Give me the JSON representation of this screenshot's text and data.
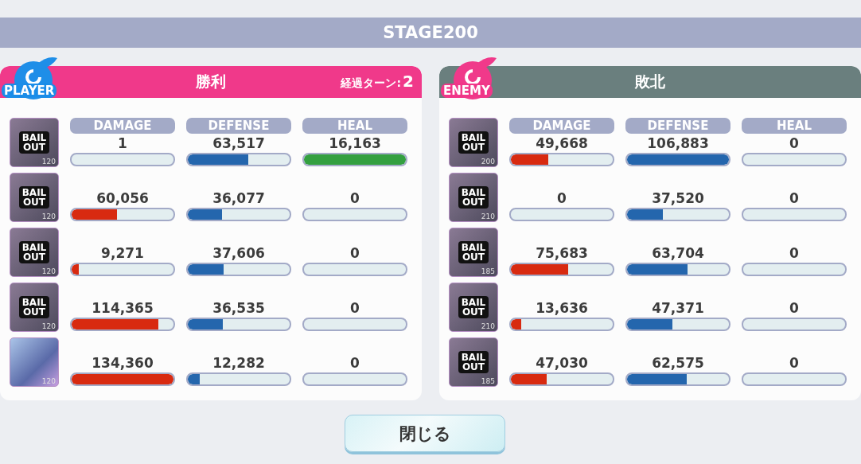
{
  "stage": {
    "title": "STAGE200"
  },
  "panels": [
    {
      "kind": "player",
      "badge": "PLAYER",
      "result": "勝利",
      "turns_label": "経過ターン:",
      "turns": "2",
      "columns": [
        {
          "label": "DAMAGE",
          "kind": "damage"
        },
        {
          "label": "DEFENSE",
          "kind": "defense"
        },
        {
          "label": "HEAL",
          "kind": "heal"
        }
      ],
      "rows": [
        {
          "card": {
            "level": "120",
            "overlay": "BAIL OUT"
          },
          "stats": [
            {
              "value": "1",
              "level": 0
            },
            {
              "value": "63,517",
              "level": 0.594
            },
            {
              "value": "16,163",
              "level": 1
            }
          ]
        },
        {
          "card": {
            "level": "120",
            "overlay": "BAIL OUT"
          },
          "stats": [
            {
              "value": "60,056",
              "level": 0.447
            },
            {
              "value": "36,077",
              "level": 0.338
            },
            {
              "value": "0",
              "level": 0
            }
          ]
        },
        {
          "card": {
            "level": "120",
            "overlay": "BAIL OUT"
          },
          "stats": [
            {
              "value": "9,271",
              "level": 0.069
            },
            {
              "value": "37,606",
              "level": 0.352
            },
            {
              "value": "0",
              "level": 0
            }
          ]
        },
        {
          "card": {
            "level": "120",
            "overlay": "BAIL OUT"
          },
          "stats": [
            {
              "value": "114,365",
              "level": 0.851
            },
            {
              "value": "36,535",
              "level": 0.342
            },
            {
              "value": "0",
              "level": 0
            }
          ]
        },
        {
          "card": {
            "level": "120"
          },
          "stats": [
            {
              "value": "134,360",
              "level": 1
            },
            {
              "value": "12,282",
              "level": 0.115
            },
            {
              "value": "0",
              "level": 0
            }
          ]
        }
      ]
    },
    {
      "kind": "enemy",
      "badge": "ENEMY",
      "result": "敗北",
      "columns": [
        {
          "label": "DAMAGE",
          "kind": "damage"
        },
        {
          "label": "DEFENSE",
          "kind": "defense"
        },
        {
          "label": "HEAL",
          "kind": "heal"
        }
      ],
      "rows": [
        {
          "card": {
            "level": "200",
            "overlay": "BAIL OUT"
          },
          "stats": [
            {
              "value": "49,668",
              "level": 0.37
            },
            {
              "value": "106,883",
              "level": 1
            },
            {
              "value": "0",
              "level": 0
            }
          ]
        },
        {
          "card": {
            "level": "210",
            "overlay": "BAIL OUT"
          },
          "stats": [
            {
              "value": "0",
              "level": 0
            },
            {
              "value": "37,520",
              "level": 0.351
            },
            {
              "value": "0",
              "level": 0
            }
          ]
        },
        {
          "card": {
            "level": "185",
            "overlay": "BAIL OUT"
          },
          "stats": [
            {
              "value": "75,683",
              "level": 0.563
            },
            {
              "value": "63,704",
              "level": 0.596
            },
            {
              "value": "0",
              "level": 0
            }
          ]
        },
        {
          "card": {
            "level": "210",
            "overlay": "BAIL OUT"
          },
          "stats": [
            {
              "value": "13,636",
              "level": 0.101
            },
            {
              "value": "47,371",
              "level": 0.443
            },
            {
              "value": "0",
              "level": 0
            }
          ]
        },
        {
          "card": {
            "level": "185",
            "overlay": "BAIL OUT"
          },
          "stats": [
            {
              "value": "47,030",
              "level": 0.35
            },
            {
              "value": "62,575",
              "level": 0.585
            },
            {
              "value": "0",
              "level": 0
            }
          ]
        }
      ]
    }
  ],
  "close_button": {
    "label": "閉じる"
  }
}
